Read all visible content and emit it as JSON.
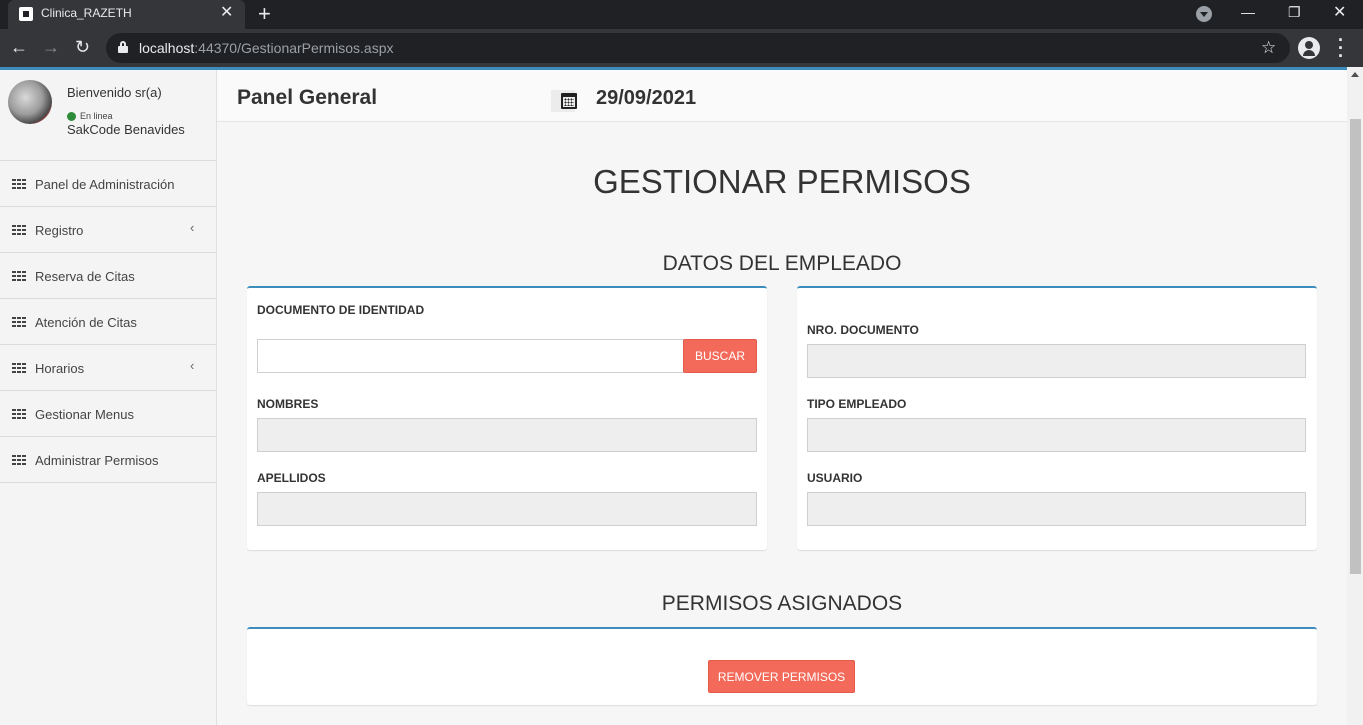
{
  "browser": {
    "tab_title": "Clinica_RAZETH",
    "url_host": "localhost",
    "url_rest": ":44370/GestionarPermisos.aspx"
  },
  "sidebar": {
    "welcome": "Bienvenido sr(a)",
    "status": "En linea",
    "username": "SakCode Benavides",
    "items": [
      {
        "label": "Panel de Administración",
        "has_chevron": false
      },
      {
        "label": "Registro",
        "has_chevron": true
      },
      {
        "label": "Reserva de Citas",
        "has_chevron": false
      },
      {
        "label": "Atención de Citas",
        "has_chevron": false
      },
      {
        "label": "Horarios",
        "has_chevron": true
      },
      {
        "label": "Gestionar Menus",
        "has_chevron": false
      },
      {
        "label": "Administrar Permisos",
        "has_chevron": false
      }
    ]
  },
  "header": {
    "title": "Panel General",
    "date": "29/09/2021"
  },
  "main": {
    "page_title": "GESTIONAR PERMISOS",
    "employee_section": "DATOS DEL EMPLEADO",
    "doc_label": "DOCUMENTO DE IDENTIDAD",
    "doc_value": "",
    "search_button": "BUSCAR",
    "nombres_label": "NOMBRES",
    "nombres_value": "",
    "apellidos_label": "APELLIDOS",
    "apellidos_value": "",
    "nro_doc_label": "NRO. DOCUMENTO",
    "nro_doc_value": "",
    "tipo_label": "TIPO EMPLEADO",
    "tipo_value": "",
    "usuario_label": "USUARIO",
    "usuario_value": "",
    "permisos_section": "PERMISOS ASIGNADOS",
    "remove_button": "REMOVER PERMISOS"
  },
  "colors": {
    "accent": "#3c8dbc",
    "button": "#f36a5a",
    "online": "#2e8b3a"
  }
}
